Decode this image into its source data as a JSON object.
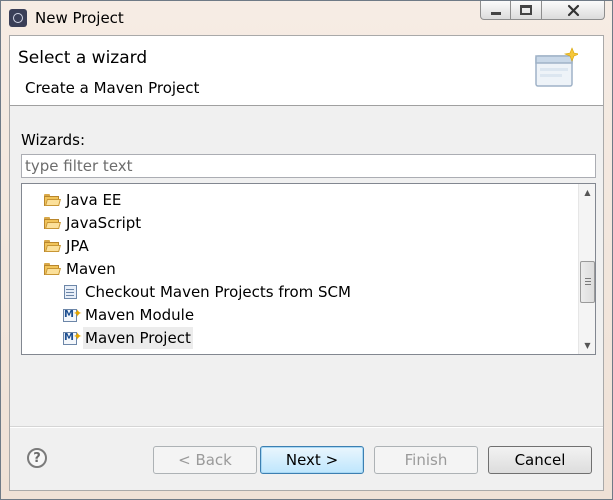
{
  "window": {
    "title": "New Project",
    "controls": {
      "minimize": "minimize-icon",
      "maximize": "maximize-icon",
      "close": "close-icon"
    }
  },
  "header": {
    "title": "Select a wizard",
    "description": "Create a Maven Project"
  },
  "wizards": {
    "label": "Wizards:",
    "filter_placeholder": "type filter text",
    "filter_value": ""
  },
  "tree": {
    "items": [
      {
        "label": "Java EE",
        "icon": "folder-icon",
        "level": 1
      },
      {
        "label": "JavaScript",
        "icon": "folder-icon",
        "level": 1
      },
      {
        "label": "JPA",
        "icon": "folder-icon",
        "level": 1
      },
      {
        "label": "Maven",
        "icon": "folder-icon",
        "level": 1,
        "expanded": true
      },
      {
        "label": "Checkout Maven Projects from SCM",
        "icon": "scm-checkout-icon",
        "level": 2
      },
      {
        "label": "Maven Module",
        "icon": "maven-module-icon",
        "level": 2
      },
      {
        "label": "Maven Project",
        "icon": "maven-project-icon",
        "level": 2,
        "selected": true
      }
    ],
    "scroll_position": 0.55
  },
  "buttons": {
    "help": "?",
    "back": "< Back",
    "next": "Next >",
    "finish": "Finish",
    "cancel": "Cancel"
  },
  "colors": {
    "default_button_border": "#3c7fb1",
    "selection_bg": "#ececec"
  }
}
